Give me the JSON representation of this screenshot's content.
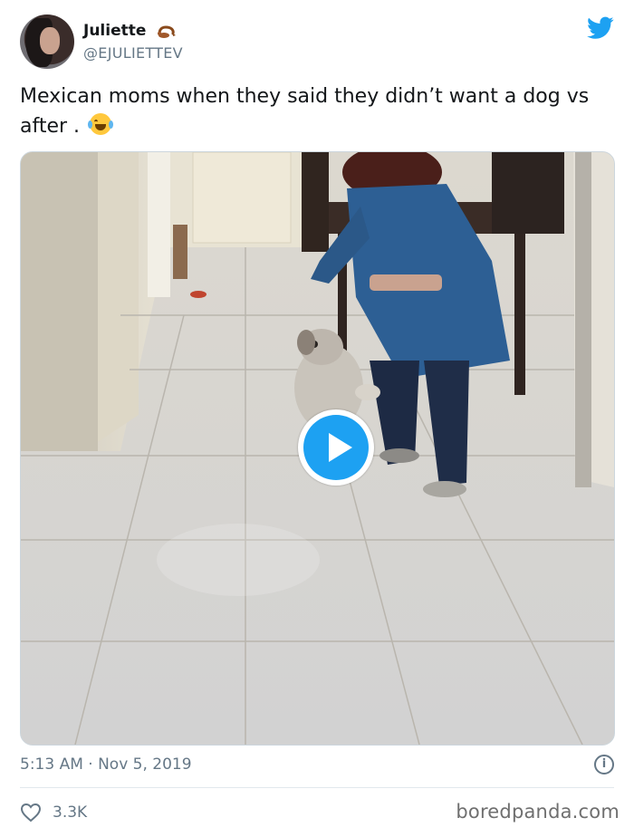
{
  "tweet": {
    "author_name": "Juliette",
    "author_handle": "@EJULIETTEV",
    "text": "Mexican moms when they said they didn’t want a dog vs after .",
    "timestamp": "5:13 AM · Nov 5, 2019",
    "likes": "3.3K"
  },
  "icons": {
    "platform": "twitter-bird-icon",
    "name_badge": "scorpion-emoji",
    "text_emoji": "face-with-tears-of-joy-emoji",
    "play": "play-icon",
    "info": "info-icon",
    "like": "heart-icon"
  },
  "colors": {
    "accent": "#1da1f2",
    "secondary_text": "#657786"
  },
  "watermark": "boredpanda.com",
  "info_glyph": "i"
}
